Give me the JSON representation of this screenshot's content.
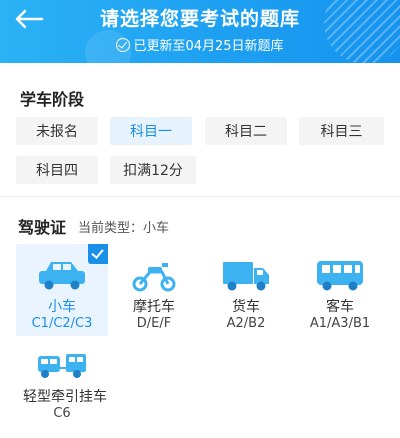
{
  "header": {
    "title": "请选择您要考试的题库",
    "subtitle": "已更新至04月25日新题库",
    "back_icon": "arrow-left-icon",
    "color": "#1ea0f2"
  },
  "stage": {
    "title": "学车阶段",
    "options": [
      "未报名",
      "科目一",
      "科目二",
      "科目三",
      "科目四",
      "扣满12分"
    ],
    "selected": "科目一"
  },
  "license": {
    "title": "驾驶证",
    "current_type": "当前类型：小车",
    "vehicles": [
      {
        "name": "小车",
        "code": "C1/C2/C3",
        "icon": "car-icon",
        "selected": true
      },
      {
        "name": "摩托车",
        "code": "D/E/F",
        "icon": "motorcycle-icon",
        "selected": false
      },
      {
        "name": "货车",
        "code": "A2/B2",
        "icon": "truck-icon",
        "selected": false
      },
      {
        "name": "客车",
        "code": "A1/A3/B1",
        "icon": "bus-icon",
        "selected": false
      },
      {
        "name": "轻型牵引挂车",
        "code": "C6",
        "icon": "trailer-icon",
        "selected": false
      }
    ]
  },
  "accent_color": "#1a8fe8"
}
